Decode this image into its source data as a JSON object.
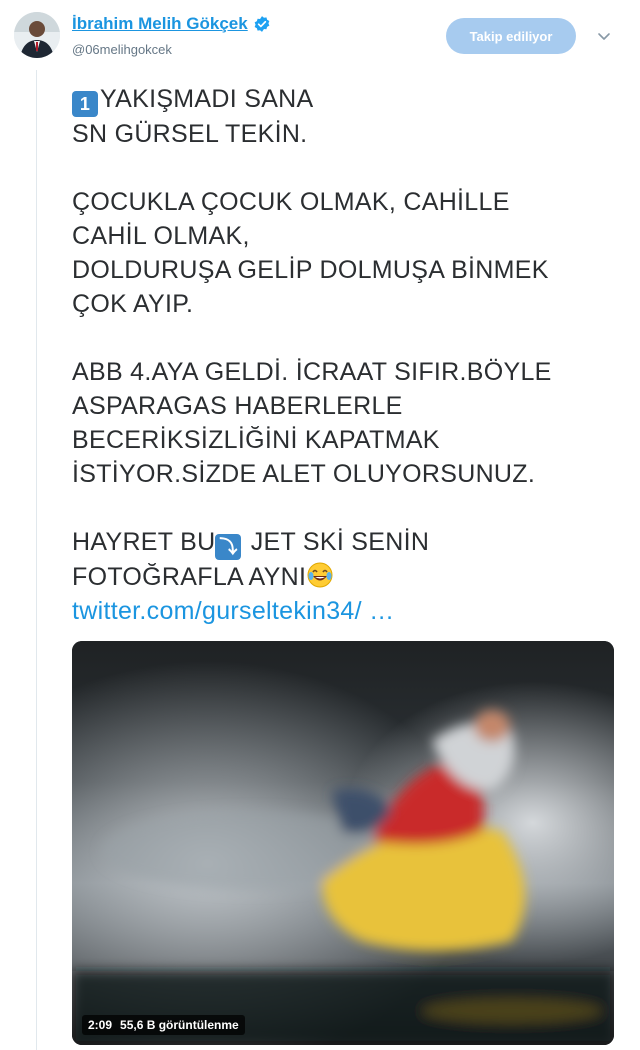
{
  "author": {
    "display_name": "İbrahim Melih Gökçek",
    "handle": "@06melihgokcek"
  },
  "follow_button_label": "Takip ediliyor",
  "tweet": {
    "line1_prefix_emoji": "1",
    "line1": "YAKIŞMADI SANA",
    "line2": "SN GÜRSEL TEKİN.",
    "line3": "ÇOCUKLA ÇOCUK OLMAK, CAHİLLE",
    "line4": "CAHİL OLMAK,",
    "line5": "DOLDURUŞA GELİP DOLMUŞA BİNMEK",
    "line6": "ÇOK AYIP.",
    "line7": "ABB 4.AYA GELDİ. İCRAAT SIFIR.BÖYLE",
    "line8": "ASPARAGAS HABERLERLE",
    "line9": "BECERİKSİZLİĞİNİ KAPATMAK",
    "line10": "İSTİYOR.SİZDE ALET OLUYORSUNUZ.",
    "line11_a": "HAYRET BU",
    "line11_emoji": "⤵",
    "line11_b": " JET SKİ SENİN",
    "line12": "FOTOĞRAFLA AYNI",
    "link": "twitter.com/gurseltekin34/ …"
  },
  "video": {
    "duration": "2:09",
    "views": "55,6 B görüntülenme"
  },
  "icons": {
    "verified": "verified-badge-icon",
    "caret": "chevron-down-icon",
    "laugh": "tears-of-joy-emoji"
  },
  "colors": {
    "link_blue": "#1b95e0",
    "follow_button_bg": "#a7cbef",
    "keycap_blue": "#3a87c9"
  }
}
